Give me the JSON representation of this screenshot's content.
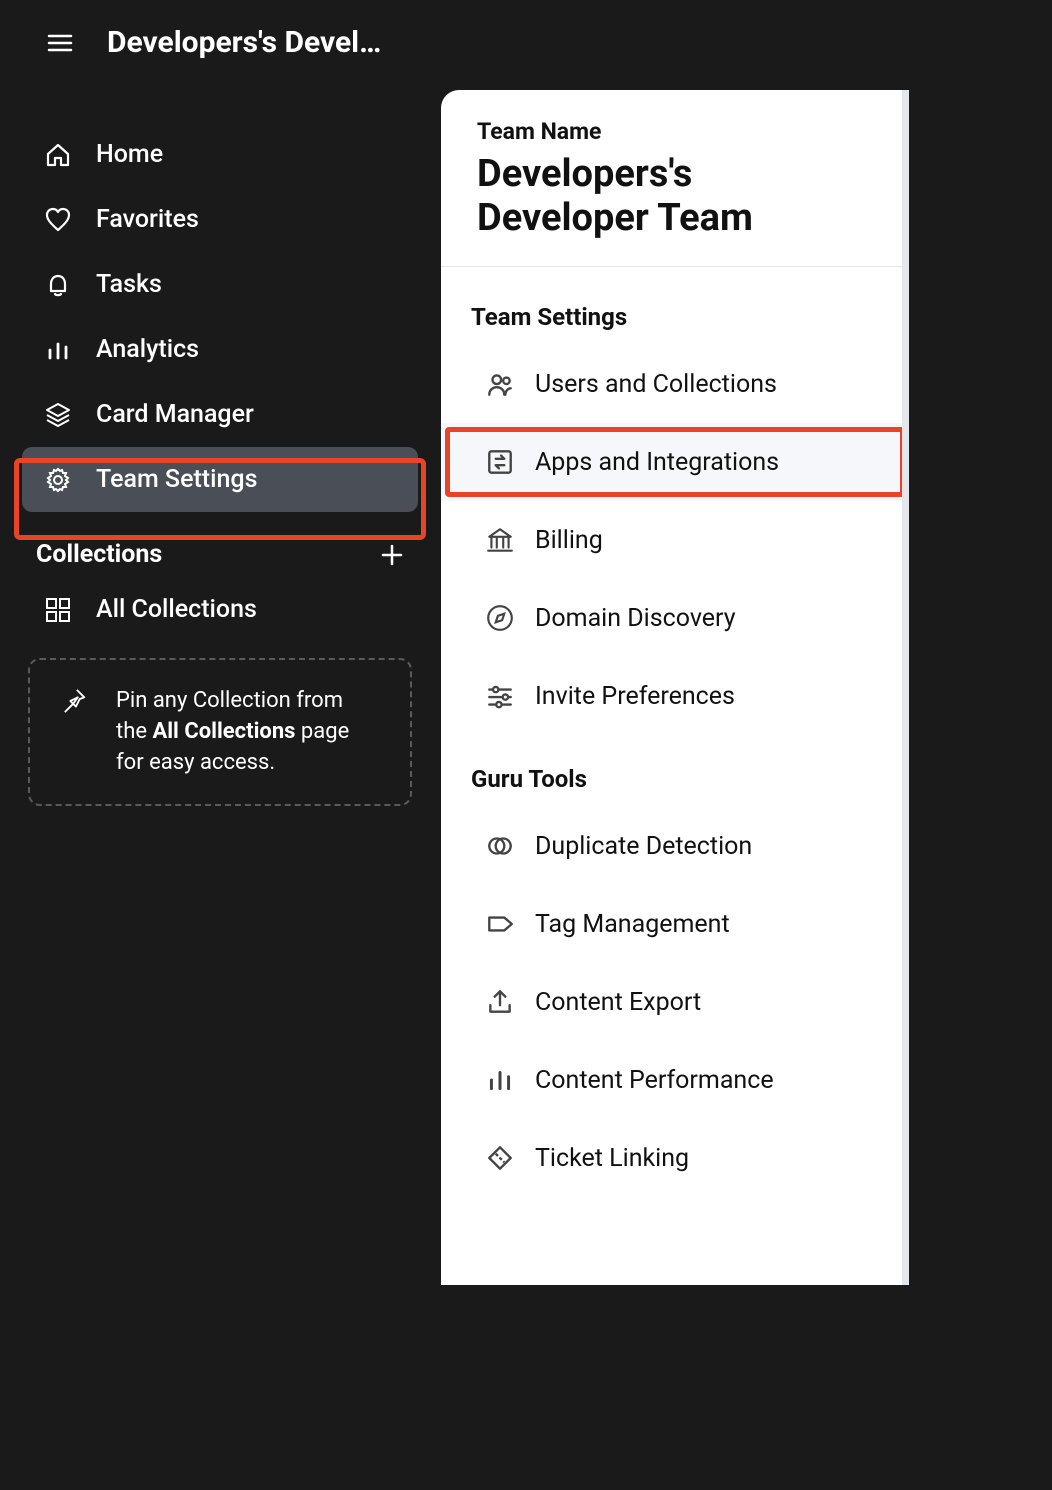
{
  "header": {
    "title": "Developers's Devel…"
  },
  "sidebar": {
    "nav": [
      {
        "key": "home",
        "label": "Home",
        "icon": "home-icon"
      },
      {
        "key": "favorites",
        "label": "Favorites",
        "icon": "heart-icon"
      },
      {
        "key": "tasks",
        "label": "Tasks",
        "icon": "bell-icon"
      },
      {
        "key": "analytics",
        "label": "Analytics",
        "icon": "chart-icon"
      },
      {
        "key": "card-manager",
        "label": "Card Manager",
        "icon": "layers-icon"
      },
      {
        "key": "team-settings",
        "label": "Team Settings",
        "icon": "gear-icon",
        "selected": true
      }
    ],
    "collections_heading": "Collections",
    "all_collections_label": "All Collections",
    "pin_hint": {
      "before": "Pin any Collection from the ",
      "bold": "All Collections",
      "after": " page for easy access."
    }
  },
  "main": {
    "team_name_label": "Team Name",
    "team_name": "Developers's Developer Team",
    "sections": [
      {
        "heading": "Team Settings",
        "items": [
          {
            "key": "users-collections",
            "label": "Users and Collections",
            "icon": "users-icon"
          },
          {
            "key": "apps-integrations",
            "label": "Apps and Integrations",
            "icon": "swap-icon",
            "selected": true
          },
          {
            "key": "billing",
            "label": "Billing",
            "icon": "bank-icon"
          },
          {
            "key": "domain-discovery",
            "label": "Domain Discovery",
            "icon": "compass-icon"
          },
          {
            "key": "invite-preferences",
            "label": "Invite Preferences",
            "icon": "sliders-icon"
          }
        ]
      },
      {
        "heading": "Guru Tools",
        "items": [
          {
            "key": "duplicate-detection",
            "label": "Duplicate Detection",
            "icon": "overlap-icon"
          },
          {
            "key": "tag-management",
            "label": "Tag Management",
            "icon": "tag-icon"
          },
          {
            "key": "content-export",
            "label": "Content Export",
            "icon": "export-icon"
          },
          {
            "key": "content-performance",
            "label": "Content Performance",
            "icon": "bar-chart-icon"
          },
          {
            "key": "ticket-linking",
            "label": "Ticket Linking",
            "icon": "ticket-icon"
          }
        ]
      }
    ]
  }
}
